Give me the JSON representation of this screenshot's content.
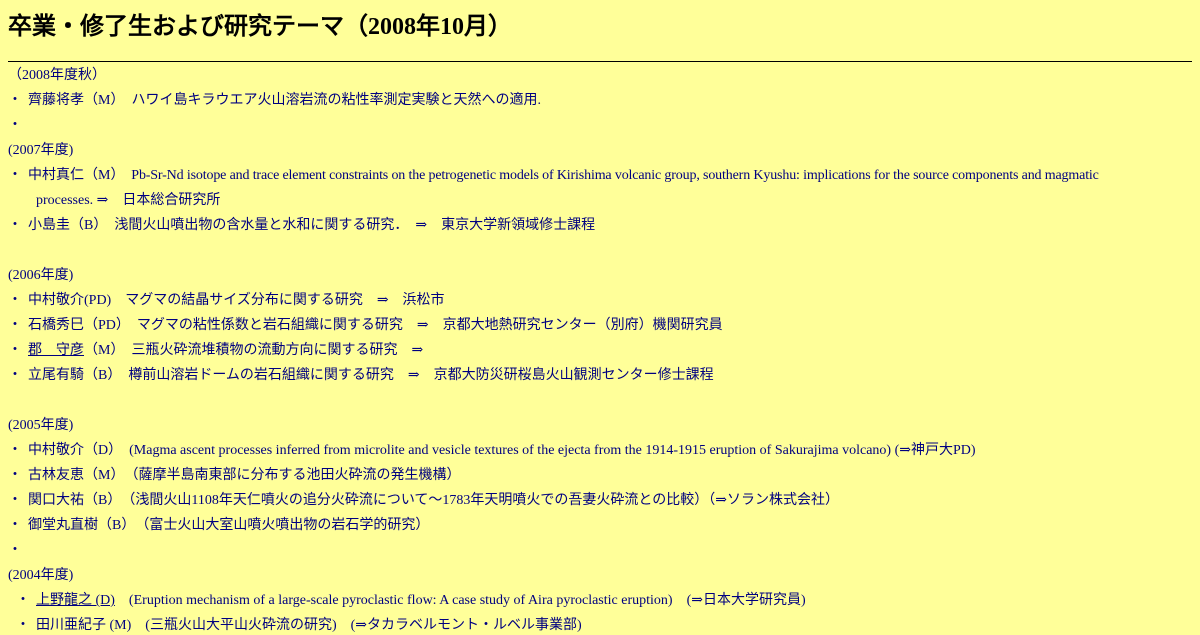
{
  "title": "卒業・修了生および研究テーマ（2008年10月）",
  "sections": {
    "y2008": {
      "heading": "（2008年度秋）",
      "items": [
        {
          "name": "齊藤将孝（M）",
          "text": "　ハワイ島キラウエア火山溶岩流の粘性率測定実験と天然への適用."
        }
      ],
      "trailing_bullet": "・"
    },
    "y2007": {
      "heading": "(2007年度)",
      "items": [
        {
          "name": "中村真仁（M）",
          "text": "　Pb-Sr-Nd isotope and trace element constraints on the petrogenetic models of Kirishima volcanic group, southern Kyushu: implications for the source components and magmatic",
          "text2": "processes.  ⇒　日本総合研究所"
        },
        {
          "name": "小島圭（B）",
          "text": "　浅間火山噴出物の含水量と水和に関する研究．　⇒　東京大学新領域修士課程"
        }
      ]
    },
    "y2006": {
      "heading": "(2006年度)",
      "items": [
        {
          "name": "中村敬介(PD)",
          "text": "　マグマの結晶サイズ分布に関する研究　⇒　浜松市"
        },
        {
          "name": "石橋秀巳（PD）",
          "text": "　マグマの粘性係数と岩石組織に関する研究　⇒　京都大地熱研究センター（別府）機関研究員"
        },
        {
          "name": "郡　守彦",
          "name_suffix": "（M）",
          "text": "　三瓶火砕流堆積物の流動方向に関する研究　⇒"
        },
        {
          "name": "立尾有騎（B）",
          "text": "　樽前山溶岩ドームの岩石組織に関する研究　⇒　京都大防災研桜島火山観測センター修士課程"
        }
      ]
    },
    "y2005": {
      "heading": "(2005年度)",
      "items": [
        {
          "name": "中村敬介（D）",
          "text": "　(Magma ascent processes inferred from microlite and vesicle textures of the ejecta from the 1914-1915 eruption of Sakurajima volcano) (⇒神戸大PD)"
        },
        {
          "name": "古林友恵（M）",
          "text": "　（薩摩半島南東部に分布する池田火砕流の発生機構）"
        },
        {
          "name": "関口大祐（B）",
          "text": "　（浅間火山1108年天仁噴火の追分火砕流について～1783年天明噴火での吾妻火砕流との比較）（⇒ソラン株式会社）"
        },
        {
          "name": "御堂丸直樹（B）",
          "text": "　（富士火山大室山噴火噴出物の岩石学的研究）"
        }
      ],
      "trailing_bullet": "・"
    },
    "y2004": {
      "heading": "(2004年度)",
      "items": [
        {
          "name": "上野龍之 (D)",
          "text": "　(Eruption mechanism of a large-scale pyroclastic flow: A case study of Aira pyroclastic eruption)　(⇒日本大学研究員)"
        },
        {
          "name": "田川亜紀子 (M)",
          "text": "　(三瓶火山大平山火砕流の研究)　(⇒タカラベルモント・ルベル事業部)"
        }
      ]
    }
  },
  "bullet": "・"
}
